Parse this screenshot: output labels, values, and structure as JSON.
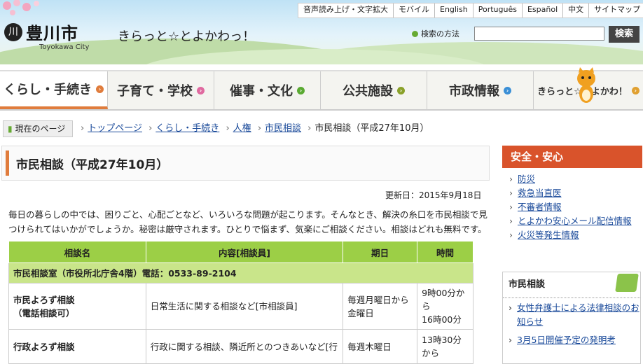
{
  "header": {
    "top_links": [
      "音声読み上げ・文字拡大",
      "モバイル",
      "English",
      "Português",
      "Español",
      "中文",
      "サイトマップ"
    ],
    "logo_glyph": "川",
    "city_name": "豊川市",
    "city_name_en": "Toyokawa City",
    "tagline": "きらっと☆とよかわっ！",
    "search_help": "検索の方法",
    "search_placeholder": "",
    "search_button": "検索"
  },
  "global_nav": [
    {
      "label": "くらし・手続き",
      "icon_color": "#e07c3c",
      "active": true
    },
    {
      "label": "子育て・学校",
      "icon_color": "#e06aa0",
      "active": false
    },
    {
      "label": "催事・文化",
      "icon_color": "#5aaa32",
      "active": false
    },
    {
      "label": "公共施設",
      "icon_color": "#8aa12a",
      "active": false
    },
    {
      "label": "市政情報",
      "icon_color": "#3a8fd6",
      "active": false
    },
    {
      "label": "きらっと☆とよかわ！",
      "icon_color": "#e0a030",
      "active": false
    }
  ],
  "breadcrumb": {
    "here_label": "現在のページ",
    "items": [
      "トップページ",
      "くらし・手続き",
      "人権",
      "市民相談"
    ],
    "current": "市民相談（平成27年10月）"
  },
  "page": {
    "title": "市民相談（平成27年10月）",
    "updated": "更新日：2015年9月18日",
    "intro": "毎日の暮らしの中では、困りごと、心配ごとなど、いろいろな問題が起こります。そんなとき、解決の糸口を市民相談で見つけられてはいかがでしょうか。秘密は厳守されます。ひとりで悩まず、気楽にご相談ください。相談はどれも無料です。"
  },
  "table": {
    "headers": [
      "相談名",
      "内容[相談員]",
      "期日",
      "時間"
    ],
    "group": "市民相談室（市役所北庁舎4階）電話：0533-89-2104",
    "rows": [
      {
        "name": "市民よろず相談\n（電話相談可）",
        "content": "日常生活に関する相談など[市相談員]",
        "date": "毎週月曜日から金曜日",
        "time": "9時00分から\n16時00分"
      },
      {
        "name": "行政よろず相談",
        "content": "行政に関する相談、隣近所とのつきあいなど[行",
        "date": "毎週木曜日",
        "time": "13時30分から"
      }
    ]
  },
  "sidebar": {
    "safety_title": "安全・安心",
    "safety_links": [
      "防災",
      "救急当直医",
      "不審者情報",
      "とよかわ安心メール配信情報",
      "火災等発生情報"
    ],
    "related_title": "市民相談",
    "related_links": [
      "女性弁護士による法律相談のお知らせ",
      "3月5日開催予定の発明考"
    ]
  }
}
